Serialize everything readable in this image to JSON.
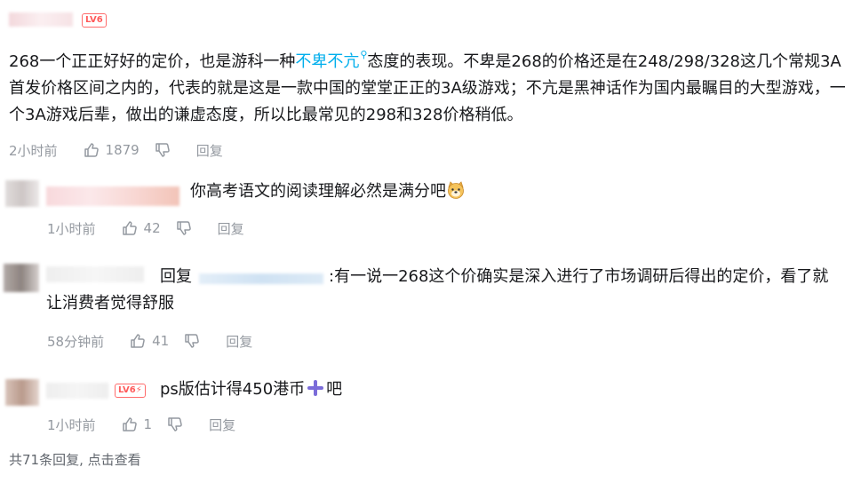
{
  "main_comment": {
    "level_badge": "LV6",
    "text_before": "268一个正正好好的定价，也是游科一种",
    "link_text": "不卑不亢",
    "text_after": "态度的表现。不卑是268的价格还是在248/298/328这几个常规3A首发价格区间之内的，代表的就是这是一款中国的堂堂正正的3A级游戏；不亢是黑神话作为国内最瞩目的大型游戏，一个3A游戏后辈，做出的谦虚态度，所以比最常见的298和328价格稍低。",
    "time": "2小时前",
    "likes": "1879",
    "reply_label": "回复"
  },
  "replies": [
    {
      "text": "你高考语文的阅读理解必然是满分吧",
      "emoji": "doge",
      "time": "1小时前",
      "likes": "42",
      "reply_label": "回复"
    },
    {
      "prefix": "回复",
      "text": ":有一说一268这个价确实是深入进行了市场调研后得出的定价，看了就让消费者觉得舒服",
      "time": "58分钟前",
      "likes": "41",
      "reply_label": "回复"
    },
    {
      "level_badge": "LV6",
      "text_before": "ps版估计得450港币",
      "text_after": "吧",
      "time": "1小时前",
      "likes": "1",
      "reply_label": "回复"
    }
  ],
  "footer": {
    "text": "共71条回复, 点击查看"
  },
  "colors": {
    "link": "#00aeec",
    "meta": "#9499a0",
    "level": "#ff5a5a",
    "emoji_cross": "#7b6cd9"
  }
}
